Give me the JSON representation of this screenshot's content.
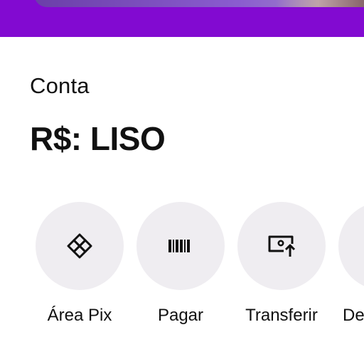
{
  "account": {
    "section_label": "Conta",
    "balance": "R$: LISO"
  },
  "actions": [
    {
      "label": "Área Pix",
      "icon": "pix-icon"
    },
    {
      "label": "Pagar",
      "icon": "barcode-icon"
    },
    {
      "label": "Transferir",
      "icon": "transfer-icon"
    },
    {
      "label": "De",
      "icon": ""
    }
  ],
  "colors": {
    "brand_purple": "#820ad1",
    "action_circle": "#efedf1",
    "text": "#111111"
  }
}
